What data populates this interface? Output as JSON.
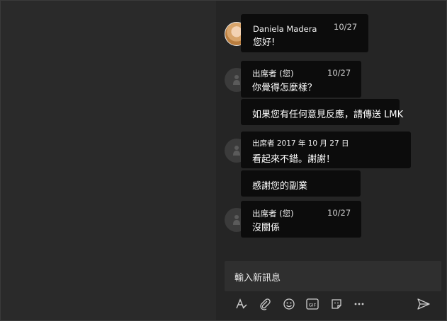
{
  "messages": [
    {
      "sender": "Daniela Madera",
      "time": "10/27",
      "lines": [
        "您好!"
      ]
    },
    {
      "sender": "出席者 (您)",
      "time": "10/27",
      "lines": [
        "你覺得怎麼樣？",
        "如果您有任何意見反應，請傳送 LMK"
      ]
    },
    {
      "sender": "出席者 2017 年 10 月 27 日",
      "time": "",
      "lines": [
        "看起來不錯。謝謝！",
        "感謝您的副業"
      ]
    },
    {
      "sender": "出席者 (您)",
      "time": "10/27",
      "lines": [
        "沒關係"
      ]
    }
  ],
  "compose": {
    "placeholder": "輸入新訊息"
  },
  "toolbar": [
    "format-icon",
    "attach-icon",
    "emoji-icon",
    "gif-icon",
    "sticker-icon",
    "more-icon",
    "send-icon"
  ],
  "colors": {
    "background": "#252525",
    "bubble": "#0c0c0c",
    "left_pane": "#2a2a2a"
  }
}
